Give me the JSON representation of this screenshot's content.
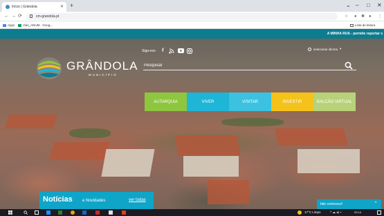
{
  "browser": {
    "tab_title": "Início | Grândola",
    "new_tab": "+",
    "url": "cm-grandola.pt",
    "bookmarks": [
      "Apps",
      "Vias_ANUM - Goog...",
      "Lista de leitura"
    ],
    "window_controls": [
      "⌄",
      "–",
      "□",
      "✕"
    ]
  },
  "site": {
    "top_strip": "A MINHA RUA - permite reportar s",
    "logo_name": "GRÂNDOLA",
    "logo_sub": "MUNICÍPIO",
    "social_label": "Siga-nos",
    "language": "selecionar idioma",
    "search_placeholder": "Pesquisar",
    "menu": [
      {
        "label": "AUTARQUIA",
        "color": "#8ec63f"
      },
      {
        "label": "VIVER",
        "color": "#1fb5d6"
      },
      {
        "label": "VISITAR",
        "color": "#3cc1e0"
      },
      {
        "label": "INVESTIR",
        "color": "#f4c21b"
      },
      {
        "label": "BALCÃO VIRTUAL",
        "color": "#b8d27a"
      }
    ],
    "news_title": "Notícias",
    "news_sub": "e Novidades",
    "news_link": "ver todas",
    "contact_label": "fale connosco!"
  },
  "taskbar": {
    "weather": "17°C Limpo",
    "time": "20:14",
    "date": "12/06/2022"
  },
  "colors": {
    "teal": "#0b7d8f",
    "accent_blue": "#0fa5c8"
  }
}
